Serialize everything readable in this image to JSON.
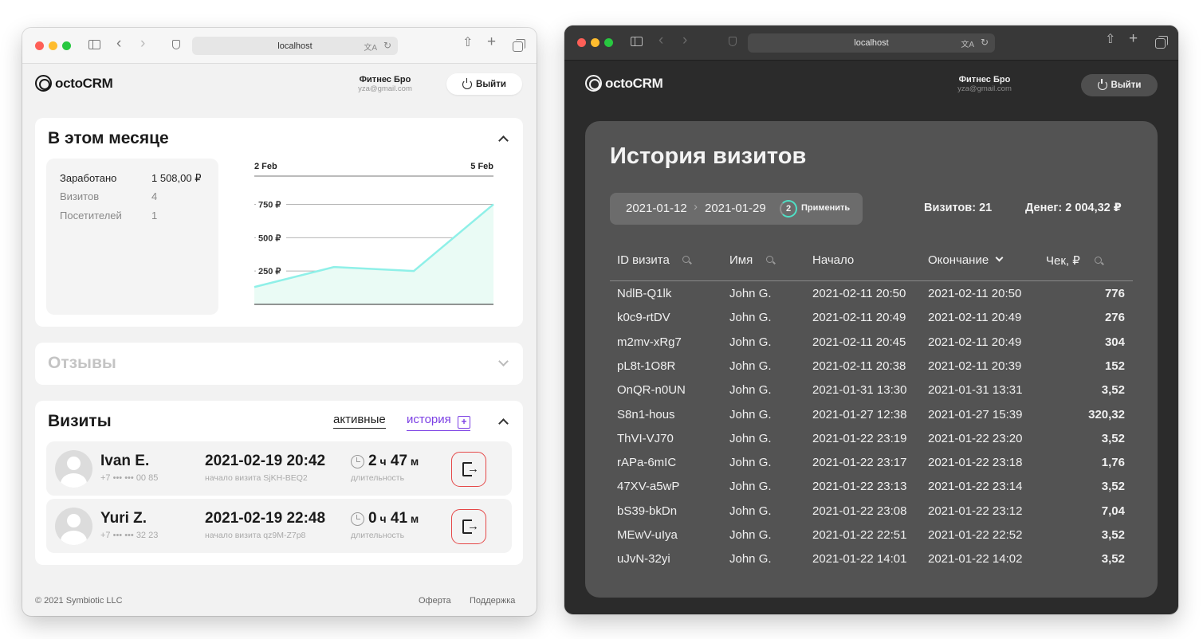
{
  "light": {
    "browser": {
      "url": "localhost"
    },
    "header": {
      "logo": "octoCRM",
      "user_name": "Фитнес Бро",
      "user_email": "yza@gmail.com",
      "logout_label": "Выйти"
    },
    "month": {
      "title": "В этом месяце",
      "stats": [
        {
          "label": "Заработано",
          "value": "1 508,00 ₽"
        },
        {
          "label": "Визитов",
          "value": "4"
        },
        {
          "label": "Посетителей",
          "value": "1"
        }
      ]
    },
    "chart_data": {
      "type": "area",
      "x_start_label": "2 Feb",
      "x_end_label": "5 Feb",
      "y_ticks": [
        "750 ₽",
        "500 ₽",
        "250 ₽"
      ],
      "y_tick_values": [
        750,
        500,
        250
      ],
      "ylim": [
        0,
        950
      ],
      "x": [
        0,
        1,
        2,
        3
      ],
      "values": [
        130,
        280,
        250,
        750
      ],
      "line_color": "#8ff0e8",
      "fill_color": "#eafbf5"
    },
    "reviews": {
      "title": "Отзывы"
    },
    "visits": {
      "title": "Визиты",
      "tab_active": "активные",
      "tab_history": "история",
      "rows": [
        {
          "name": "Ivan E.",
          "phone": "+7 ••• ••• 00 85",
          "start": "2021-02-19 20:42",
          "start_sub": "начало визита SjKH-BEQ2",
          "dur_h": "2",
          "dur_h_unit": "ч",
          "dur_m": "47",
          "dur_m_unit": "м",
          "dur_label": "длительность"
        },
        {
          "name": "Yuri Z.",
          "phone": "+7 ••• ••• 32 23",
          "start": "2021-02-19 22:48",
          "start_sub": "начало визита qz9M-Z7p8",
          "dur_h": "0",
          "dur_h_unit": "ч",
          "dur_m": "41",
          "dur_m_unit": "м",
          "dur_label": "длительность"
        }
      ]
    },
    "footer": {
      "copyright": "© 2021 Symbiotic LLC",
      "offer": "Оферта",
      "support": "Поддержка"
    }
  },
  "dark": {
    "browser": {
      "url": "localhost"
    },
    "header": {
      "logo": "octoCRM",
      "user_name": "Фитнес Бро",
      "user_email": "yza@gmail.com",
      "logout_label": "Выйти"
    },
    "history": {
      "title": "История визитов",
      "date_from": "2021-01-12",
      "date_to": "2021-01-29",
      "filter_count": "2",
      "apply_label": "Применить",
      "visits_label": "Визитов:",
      "visits_value": "21",
      "money_label": "Денег:",
      "money_value": "2 004,32 ₽",
      "columns": [
        "ID визита",
        "Имя",
        "Начало",
        "Окончание",
        "Чек, ₽"
      ],
      "rows": [
        [
          "NdlB-Q1lk",
          "John G.",
          "2021-02-11 20:50",
          "2021-02-11 20:50",
          "776"
        ],
        [
          "k0c9-rtDV",
          "John G.",
          "2021-02-11 20:49",
          "2021-02-11 20:49",
          "276"
        ],
        [
          "m2mv-xRg7",
          "John G.",
          "2021-02-11 20:45",
          "2021-02-11 20:49",
          "304"
        ],
        [
          "pL8t-1O8R",
          "John G.",
          "2021-02-11 20:38",
          "2021-02-11 20:39",
          "152"
        ],
        [
          "OnQR-n0UN",
          "John G.",
          "2021-01-31 13:30",
          "2021-01-31 13:31",
          "3,52"
        ],
        [
          "S8n1-hous",
          "John G.",
          "2021-01-27 12:38",
          "2021-01-27 15:39",
          "320,32"
        ],
        [
          "ThVI-VJ70",
          "John G.",
          "2021-01-22 23:19",
          "2021-01-22 23:20",
          "3,52"
        ],
        [
          "rAPa-6mIC",
          "John G.",
          "2021-01-22 23:17",
          "2021-01-22 23:18",
          "1,76"
        ],
        [
          "47XV-a5wP",
          "John G.",
          "2021-01-22 23:13",
          "2021-01-22 23:14",
          "3,52"
        ],
        [
          "bS39-bkDn",
          "John G.",
          "2021-01-22 23:08",
          "2021-01-22 23:12",
          "7,04"
        ],
        [
          "MEwV-uIya",
          "John G.",
          "2021-01-22 22:51",
          "2021-01-22 22:52",
          "3,52"
        ],
        [
          "uJvN-32yi",
          "John G.",
          "2021-01-22 14:01",
          "2021-01-22 14:02",
          "3,52"
        ]
      ]
    }
  },
  "colors": {
    "accent_purple": "#7b3fe4",
    "danger": "#e54848",
    "teal": "#4fe0c6"
  }
}
